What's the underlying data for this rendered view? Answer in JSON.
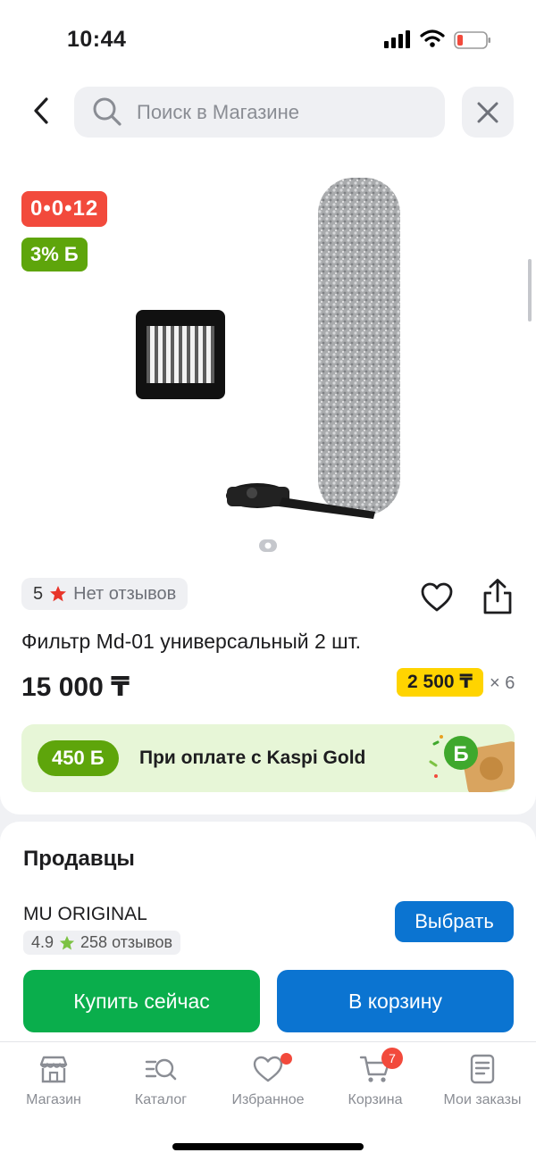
{
  "status_bar": {
    "time": "10:44"
  },
  "header": {
    "search_placeholder": "Поиск в Магазине"
  },
  "product": {
    "badge_timer": "0•0•12",
    "badge_bonus": "3% Б",
    "rating_value": "5",
    "reviews_text": "Нет отзывов",
    "title": "Фильтр Md-01 универсальный 2 шт.",
    "price": "15 000 ₸",
    "installment_amount": "2 500 ₸",
    "installment_months": "× 6",
    "image_page_index": 1,
    "image_page_count": 1
  },
  "kaspi_gold": {
    "bonus": "450 Б",
    "text": "При оплате с Kaspi Gold"
  },
  "sellers": {
    "title": "Продавцы",
    "seller_name": "MU ORIGINAL",
    "seller_rating": "4.9",
    "seller_reviews": "258 отзывов",
    "select_label": "Выбрать"
  },
  "actions": {
    "buy_now": "Купить сейчас",
    "add_to_cart": "В корзину"
  },
  "nav": {
    "items": [
      {
        "label": "Магазин",
        "icon": "store-icon"
      },
      {
        "label": "Каталог",
        "icon": "catalog-search-icon"
      },
      {
        "label": "Избранное",
        "icon": "heart-icon"
      },
      {
        "label": "Корзина",
        "icon": "cart-icon"
      },
      {
        "label": "Мои заказы",
        "icon": "orders-icon"
      }
    ],
    "cart_count": "7"
  },
  "colors": {
    "accent_blue": "#0b74d1",
    "buy_green": "#0aae4c",
    "timer_red": "#f24a3c",
    "bonus_green": "#5ea50b",
    "installment_yellow": "#ffd400"
  }
}
